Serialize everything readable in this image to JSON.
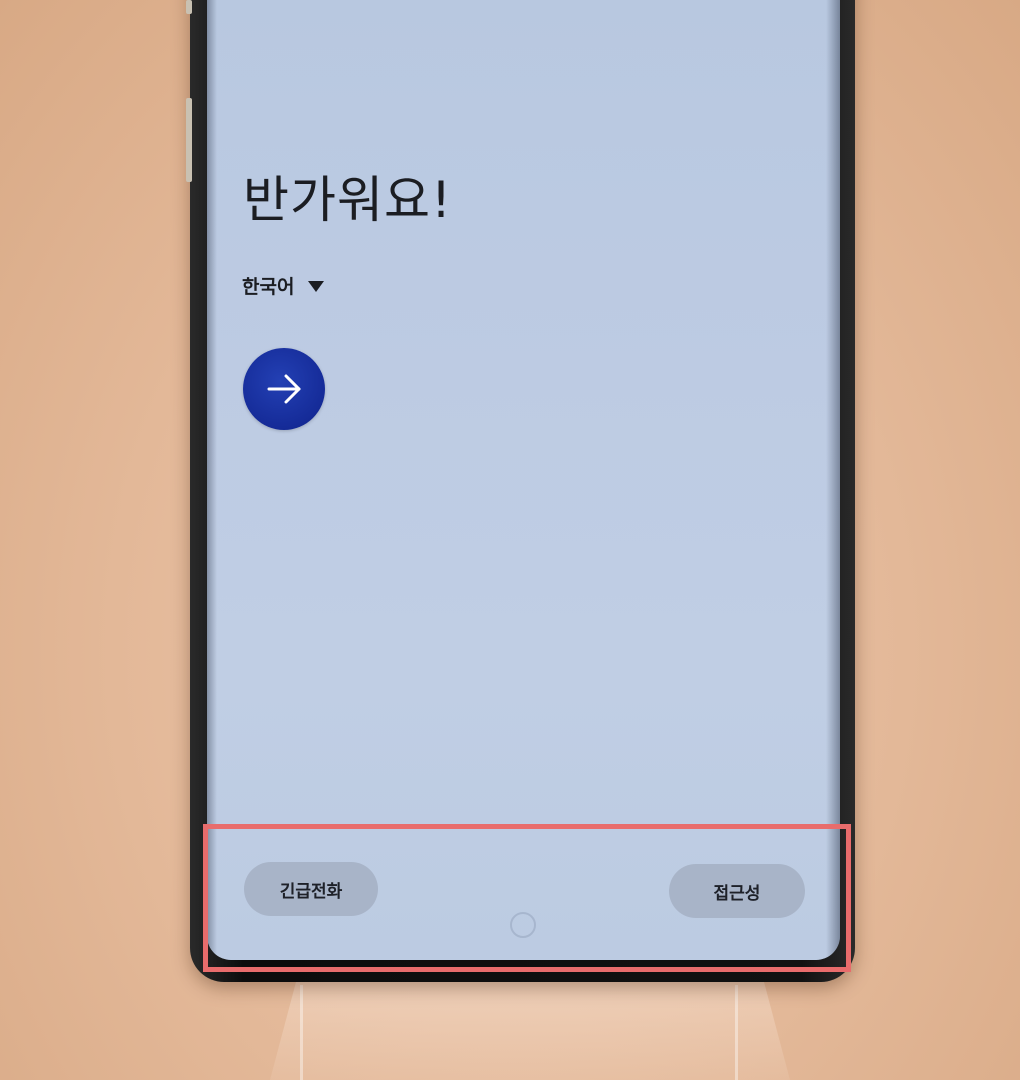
{
  "screen": {
    "headline": "반가워요!",
    "language_selector": {
      "selected": "한국어"
    },
    "next_button": {
      "icon": "arrow-right-icon"
    },
    "bottom_bar": {
      "emergency_call_label": "긴급전화",
      "accessibility_label": "접근성"
    }
  },
  "colors": {
    "screen_background": "#bdcbe3",
    "accent_button": "#152b98",
    "pill_background": "#a8b4c8",
    "highlight_border": "#e86c6c",
    "backdrop": "#e3b898"
  }
}
